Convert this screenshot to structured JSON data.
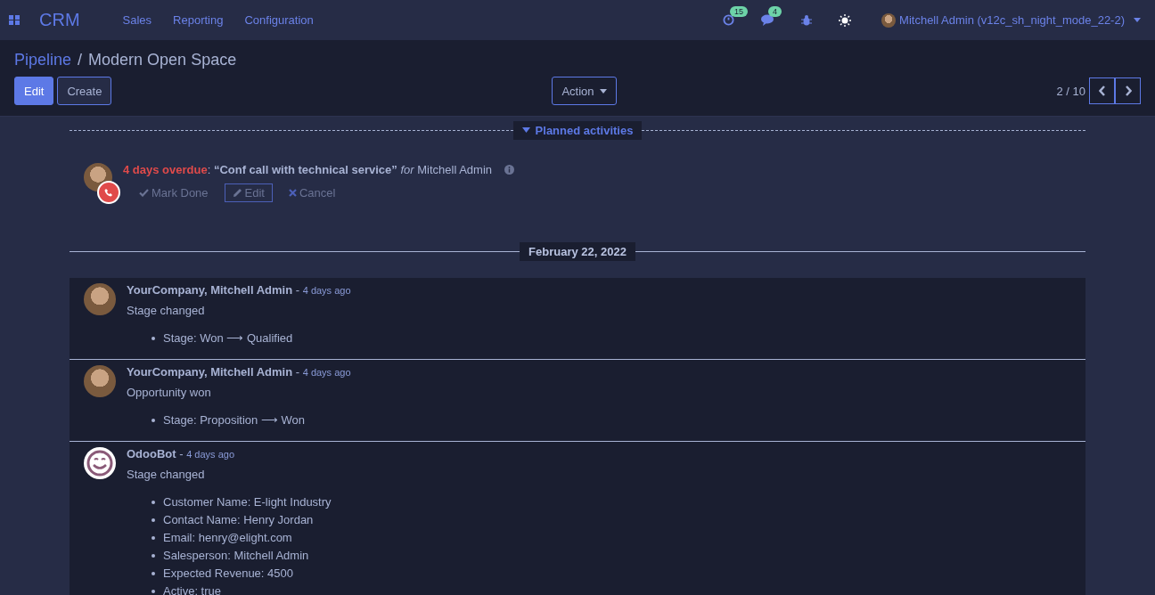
{
  "navbar": {
    "app_name": "CRM",
    "menus": [
      "Sales",
      "Reporting",
      "Configuration"
    ],
    "activity_count": "15",
    "message_count": "4",
    "user": "Mitchell Admin (v12c_sh_night_mode_22-2)"
  },
  "breadcrumb": {
    "parent": "Pipeline",
    "separator": "/",
    "current": "Modern Open Space"
  },
  "buttons": {
    "edit": "Edit",
    "create": "Create",
    "action": "Action"
  },
  "pager": {
    "value": "2 / 10"
  },
  "planned": {
    "title": "Planned activities",
    "expanded": true,
    "activity": {
      "overdue": "4 days overdue",
      "colon": ":",
      "summary": "“Conf call with technical service”",
      "for_label": "for",
      "assignee": "Mitchell Admin",
      "actions": [
        "Mark Done",
        "Edit",
        "Cancel"
      ]
    }
  },
  "date_separator": "February 22, 2022",
  "messages": [
    {
      "kind": "person",
      "author": "YourCompany, Mitchell Admin",
      "dash": "-",
      "time": "4 days ago",
      "body": "Stage changed",
      "changes": [
        "Stage: Won ⟶ Qualified"
      ]
    },
    {
      "kind": "person",
      "author": "YourCompany, Mitchell Admin",
      "dash": "-",
      "time": "4 days ago",
      "body": "Opportunity won",
      "changes": [
        "Stage: Proposition ⟶ Won"
      ]
    },
    {
      "kind": "bot",
      "author": "OdooBot",
      "dash": "-",
      "time": "4 days ago",
      "body": "Stage changed",
      "changes": [
        "Customer Name: E-light Industry",
        "Contact Name: Henry Jordan",
        "Email: henry@elight.com",
        "Salesperson: Mitchell Admin",
        "Expected Revenue: 4500",
        "Active: true"
      ]
    }
  ]
}
